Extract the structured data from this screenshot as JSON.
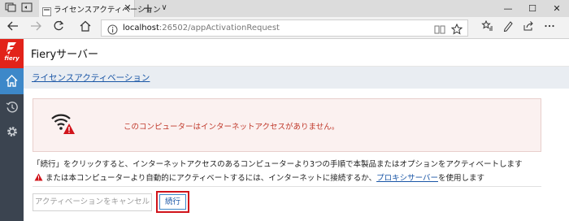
{
  "browser": {
    "tab_title": "ライセンスアクティベーション",
    "tab_close": "✕",
    "new_tab": "+",
    "tab_list": "∨",
    "url_host": "localhost",
    "url_path": ":26502/appActivationRequest",
    "window_controls": {
      "minimize": "—",
      "maximize": "☐",
      "close": "✕"
    }
  },
  "app": {
    "brand": "fiery",
    "title": "Fieryサーバー",
    "breadcrumb": "ライセンスアクティベーション"
  },
  "alert": {
    "message": "このコンピューターはインターネットアクセスがありません。",
    "color": "#c0392b"
  },
  "instructions": {
    "line1": "「続行」をクリックすると、インターネットアクセスのあるコンピューターより3つの手順で本製品またはオプションをアクティベートします",
    "line2_before": "または本コンピューターより自動的にアクティベートするには、インターネットに接続するか、",
    "line2_link": "プロキシサーバー",
    "line2_after": "を使用します"
  },
  "buttons": {
    "cancel": "アクティベーションをキャンセル",
    "continue": "続行"
  },
  "colors": {
    "sidebar": "#3b4450",
    "brand_red": "#e2231a",
    "accent_blue": "#3d88c9",
    "highlight_red": "#d1141b"
  }
}
